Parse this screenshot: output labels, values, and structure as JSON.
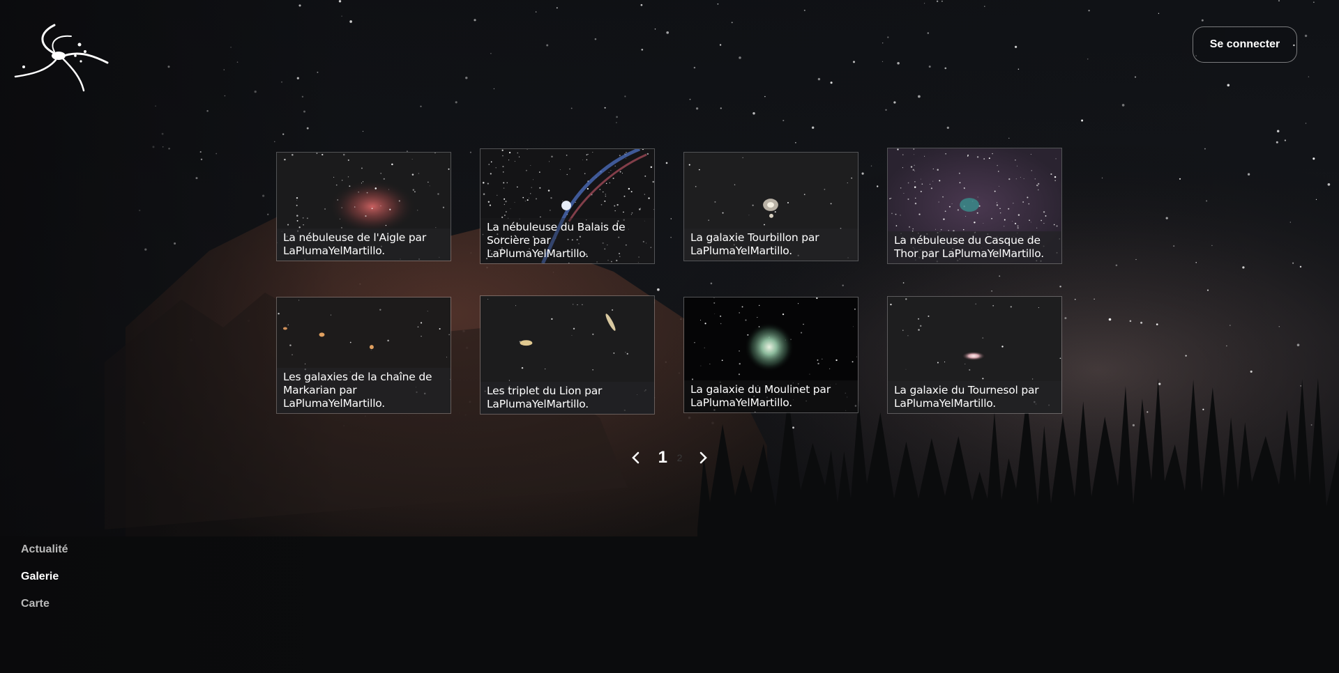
{
  "header": {
    "logo_icon": "spiral-galaxy-logo-icon",
    "login_label": "Se connecter"
  },
  "gallery": {
    "items": [
      {
        "caption": "La nébuleuse de l'Aigle par LaPlumaYelMartillo.",
        "image": "eagle-nebula"
      },
      {
        "caption": "La nébuleuse du Balais de Sorcière par LaPlumaYelMartillo.",
        "image": "witch-broom-nebula"
      },
      {
        "caption": "La galaxie Tourbillon par LaPlumaYelMartillo.",
        "image": "whirlpool-galaxy"
      },
      {
        "caption": "La nébuleuse du Casque de Thor par LaPlumaYelMartillo.",
        "image": "thors-helmet-nebula"
      },
      {
        "caption": "Les galaxies de la chaîne de Markarian par LaPlumaYelMartillo.",
        "image": "markarian-chain"
      },
      {
        "caption": "Les triplet du Lion par LaPlumaYelMartillo.",
        "image": "leo-triplet"
      },
      {
        "caption": "La galaxie du Moulinet par LaPlumaYelMartillo.",
        "image": "pinwheel-galaxy"
      },
      {
        "caption": "La galaxie du Tournesol par LaPlumaYelMartillo.",
        "image": "sunflower-galaxy"
      }
    ]
  },
  "pagination": {
    "prev_icon": "chevron-left-icon",
    "current_page": "1",
    "next_page": "2",
    "next_icon": "chevron-right-icon"
  },
  "nav": {
    "items": [
      {
        "label": "Actualité",
        "active": false
      },
      {
        "label": "Galerie",
        "active": true
      },
      {
        "label": "Carte",
        "active": false
      }
    ]
  },
  "colors": {
    "background": "#0d0d10",
    "text": "#ffffff",
    "nav_inactive": "#b9b9b9",
    "caption_bg": "#232326"
  }
}
